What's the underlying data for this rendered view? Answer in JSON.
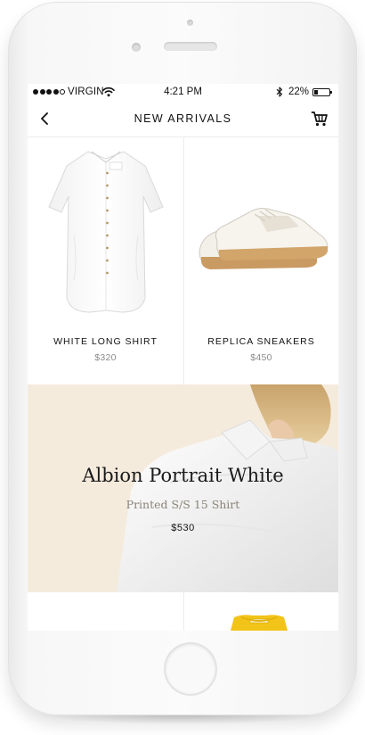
{
  "status_bar": {
    "carrier": "VIRGIN",
    "time": "4:21 PM",
    "battery_percent": "22%",
    "battery_level": 0.22,
    "signal_bars_filled": 4,
    "signal_bars_total": 5
  },
  "nav": {
    "title": "NEW ARRIVALS",
    "back_icon": "chevron-left-icon",
    "cart_icon": "cart-icon"
  },
  "products": [
    {
      "name": "WHITE LONG SHIRT",
      "price": "$320",
      "image": "white-long-shirt"
    },
    {
      "name": "REPLICA SNEAKERS",
      "price": "$450",
      "image": "replica-sneakers"
    }
  ],
  "featured": {
    "title": "Albion Portrait White",
    "subtitle": "Printed S/S 15 Shirt",
    "price": "$530",
    "background_color": "#f5ebdd"
  },
  "colors": {
    "text": "#111111",
    "muted": "#8a8a8a",
    "divider": "#ececec"
  }
}
